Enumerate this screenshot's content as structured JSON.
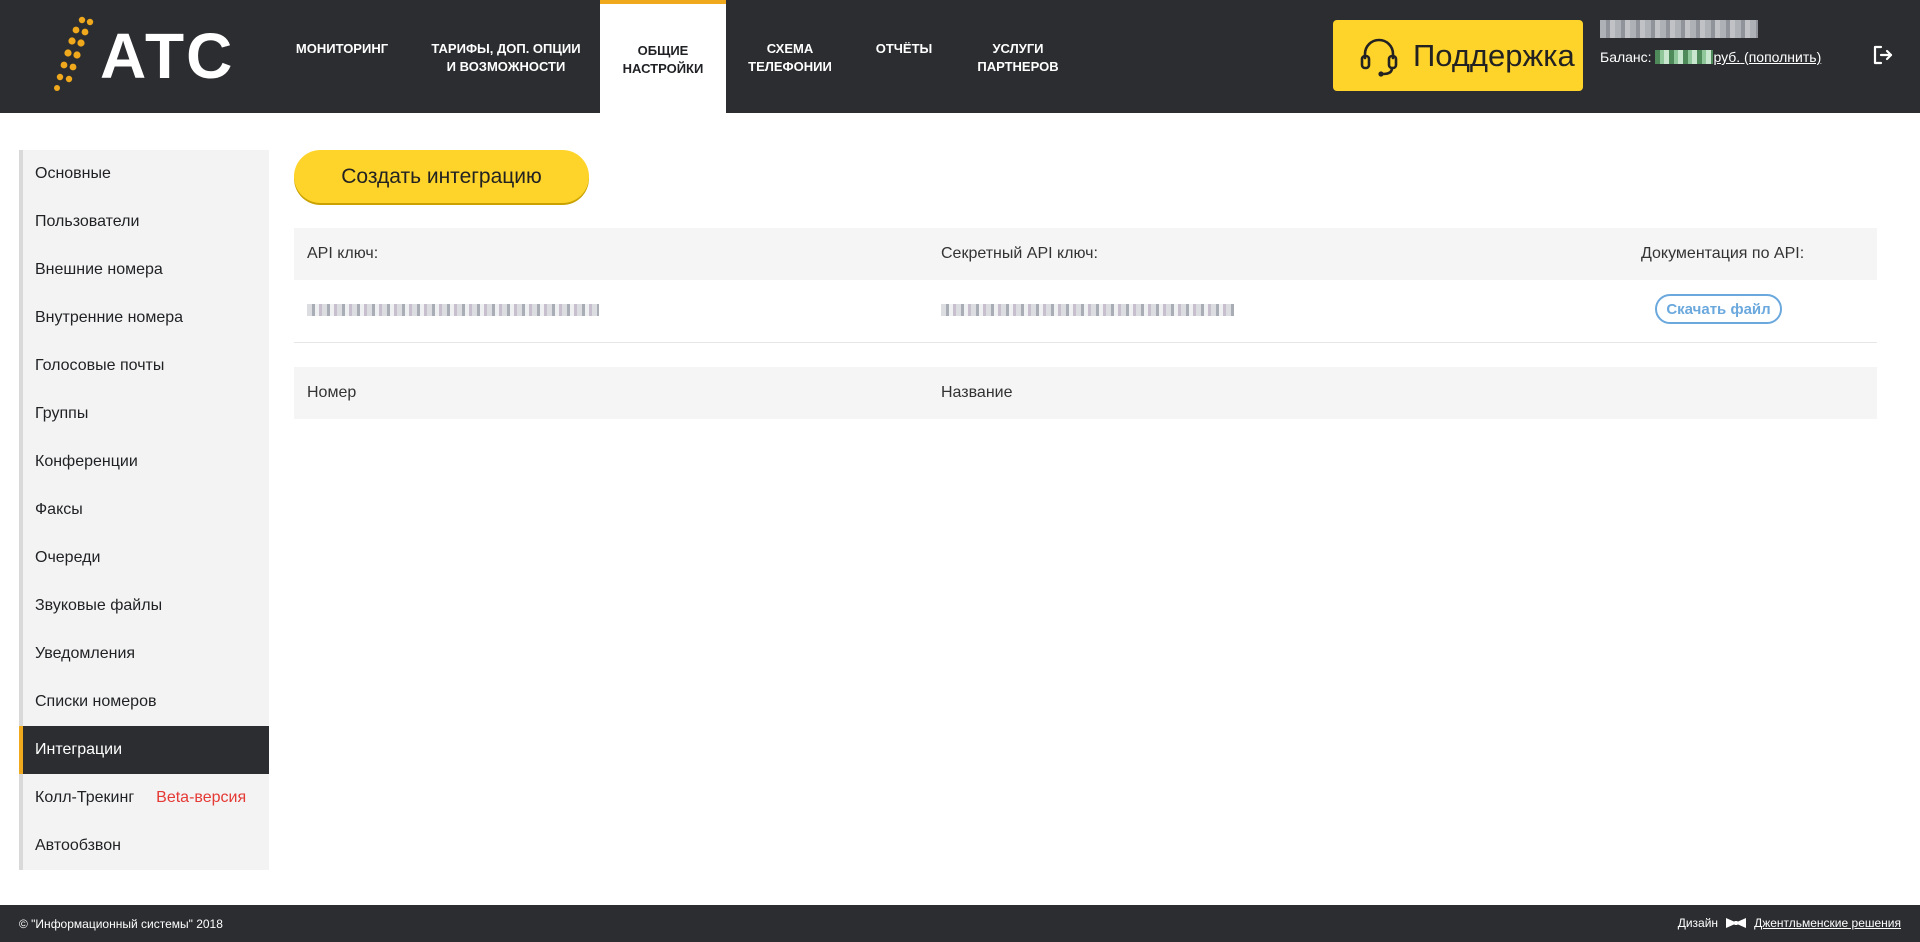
{
  "header": {
    "logo_text": "АТС",
    "nav": [
      {
        "line1": "Мониторинг",
        "line2": ""
      },
      {
        "line1": "Тарифы, доп. опции",
        "line2": "и возможности"
      },
      {
        "line1": "Общие",
        "line2": "настройки"
      },
      {
        "line1": "Схема",
        "line2": "телефонии"
      },
      {
        "line1": "Отчёты",
        "line2": ""
      },
      {
        "line1": "Услуги",
        "line2": "партнеров"
      }
    ],
    "support_label": "Поддержка",
    "balance_label": "Баланс:",
    "balance_currency": "руб.",
    "topup_label": "(пополнить)"
  },
  "sidebar": {
    "items": [
      {
        "label": "Основные"
      },
      {
        "label": "Пользователи"
      },
      {
        "label": "Внешние номера"
      },
      {
        "label": "Внутренние номера"
      },
      {
        "label": "Голосовые почты"
      },
      {
        "label": "Группы"
      },
      {
        "label": "Конференции"
      },
      {
        "label": "Факсы"
      },
      {
        "label": "Очереди"
      },
      {
        "label": "Звуковые файлы"
      },
      {
        "label": "Уведомления"
      },
      {
        "label": "Списки номеров"
      },
      {
        "label": "Интеграции"
      },
      {
        "label": "Колл-Трекинг",
        "badge": "Beta-версия"
      },
      {
        "label": "Автообзвон"
      }
    ],
    "active_index": 12
  },
  "main": {
    "create_button": "Создать интеграцию",
    "api_table": {
      "col_api_key": "API ключ:",
      "col_secret_key": "Секретный API ключ:",
      "col_docs": "Документация по API:",
      "download_label": "Скачать файл"
    },
    "numbers_table": {
      "col_number": "Номер",
      "col_name": "Название"
    }
  },
  "footer": {
    "copyright": "© \"Информационный системы\" 2018",
    "design_label": "Дизайн",
    "studio": "Джентльменские решения"
  },
  "colors": {
    "header_bg": "#2b2d30",
    "accent_yellow": "#ffd42a",
    "accent_orange": "#f0a81c",
    "link_blue": "#6aa8dd",
    "beta_red": "#e53935"
  }
}
